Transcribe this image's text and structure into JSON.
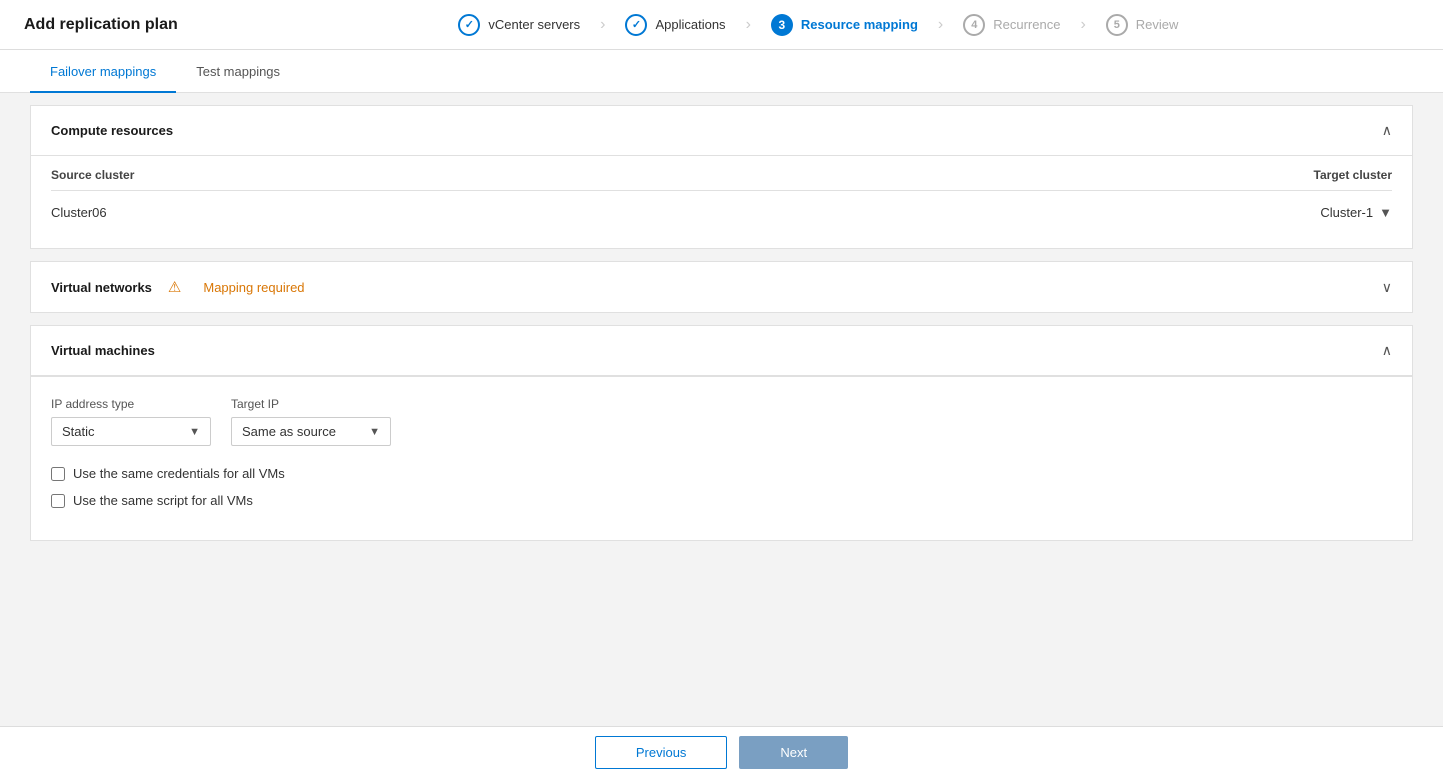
{
  "header": {
    "title": "Add replication plan"
  },
  "steps": [
    {
      "id": "vcenter",
      "number": "✓",
      "label": "vCenter servers",
      "state": "completed"
    },
    {
      "id": "applications",
      "number": "✓",
      "label": "Applications",
      "state": "completed"
    },
    {
      "id": "resource-mapping",
      "number": "3",
      "label": "Resource mapping",
      "state": "active"
    },
    {
      "id": "recurrence",
      "number": "4",
      "label": "Recurrence",
      "state": "inactive"
    },
    {
      "id": "review",
      "number": "5",
      "label": "Review",
      "state": "inactive"
    }
  ],
  "tabs": [
    {
      "id": "failover",
      "label": "Failover mappings",
      "active": true
    },
    {
      "id": "test",
      "label": "Test mappings",
      "active": false
    }
  ],
  "sections": {
    "compute": {
      "title": "Compute resources",
      "expanded": true,
      "source_cluster_header": "Source cluster",
      "target_cluster_header": "Target cluster",
      "rows": [
        {
          "source": "Cluster06",
          "target": "Cluster-1"
        }
      ]
    },
    "vnetworks": {
      "title": "Virtual networks",
      "expanded": false,
      "warning_text": "Mapping required"
    },
    "vmachines": {
      "title": "Virtual machines",
      "expanded": true,
      "ip_address_label": "IP address type",
      "ip_address_value": "Static",
      "target_ip_label": "Target IP",
      "target_ip_value": "Same as source",
      "checkboxes": [
        {
          "id": "same-creds",
          "label": "Use the same credentials for all VMs",
          "checked": false
        },
        {
          "id": "same-script",
          "label": "Use the same script for all VMs",
          "checked": false
        }
      ]
    }
  },
  "footer": {
    "prev_label": "Previous",
    "next_label": "Next"
  }
}
